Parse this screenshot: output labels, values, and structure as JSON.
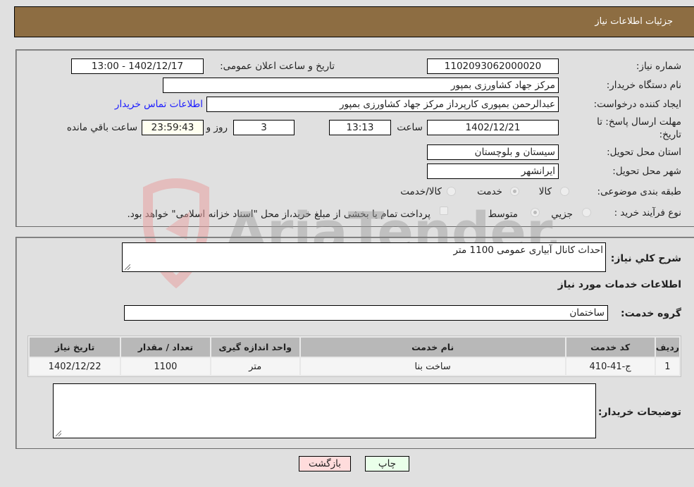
{
  "header": {
    "title": "جزئیات اطلاعات نیاز"
  },
  "form": {
    "need_number": {
      "label": "شماره نیاز:",
      "value": "1102093062000020"
    },
    "announce_datetime": {
      "label": "تاریخ و ساعت اعلان عمومی:",
      "value": "1402/12/17 - 13:00"
    },
    "buyer_org": {
      "label": "نام دستگاه خریدار:",
      "value": "مرکز جهاد کشاورزی بمپور"
    },
    "requester": {
      "label": "ایجاد کننده درخواست:",
      "value": "عبدالرحمن بمپوری کارپرداز مرکز جهاد کشاورزی بمپور"
    },
    "contact_link": "اطلاعات تماس خریدار",
    "deadline": {
      "label": "مهلت ارسال پاسخ: تا تاریخ:",
      "date": "1402/12/21",
      "time_label": "ساعت",
      "time": "13:13",
      "days": "3",
      "days_label": "روز و",
      "remaining": "23:59:43",
      "remaining_label": "ساعت باقي مانده"
    },
    "province": {
      "label": "استان محل تحویل:",
      "value": "سیستان و بلوچستان"
    },
    "city": {
      "label": "شهر محل تحویل:",
      "value": "ایرانشهر"
    },
    "category": {
      "label": "طبقه بندی موضوعی:",
      "options": [
        "کالا",
        "خدمت",
        "کالا/خدمت"
      ],
      "selected": "خدمت"
    },
    "purchase_type": {
      "label": "نوع فرآیند خرید :",
      "options": [
        "جزيي",
        "متوسط"
      ],
      "selected": "متوسط",
      "treasury_note": "پرداخت تمام یا بخشی از مبلغ خرید،از محل \"اسناد خزانه اسلامی\" خواهد بود."
    }
  },
  "details": {
    "description_label": "شرح کلي نیاز:",
    "description": "احداث کانال آبیاری عمومی 1100 متر",
    "services_heading": "اطلاعات خدمات مورد نیاز",
    "service_group_label": "گروه خدمت:",
    "service_group": "ساختمان",
    "table": {
      "headers": [
        "ردیف",
        "کد خدمت",
        "نام خدمت",
        "واحد اندازه گیری",
        "تعداد / مقدار",
        "تاریخ نیاز"
      ],
      "rows": [
        [
          "1",
          "ج-41-410",
          "ساخت بنا",
          "متر",
          "1100",
          "1402/12/22"
        ]
      ]
    },
    "buyer_notes_label": "توضیحات خریدار:",
    "buyer_notes": ""
  },
  "buttons": {
    "print": "چاپ",
    "back": "بازگشت"
  },
  "watermark": "AriaTender.neT"
}
